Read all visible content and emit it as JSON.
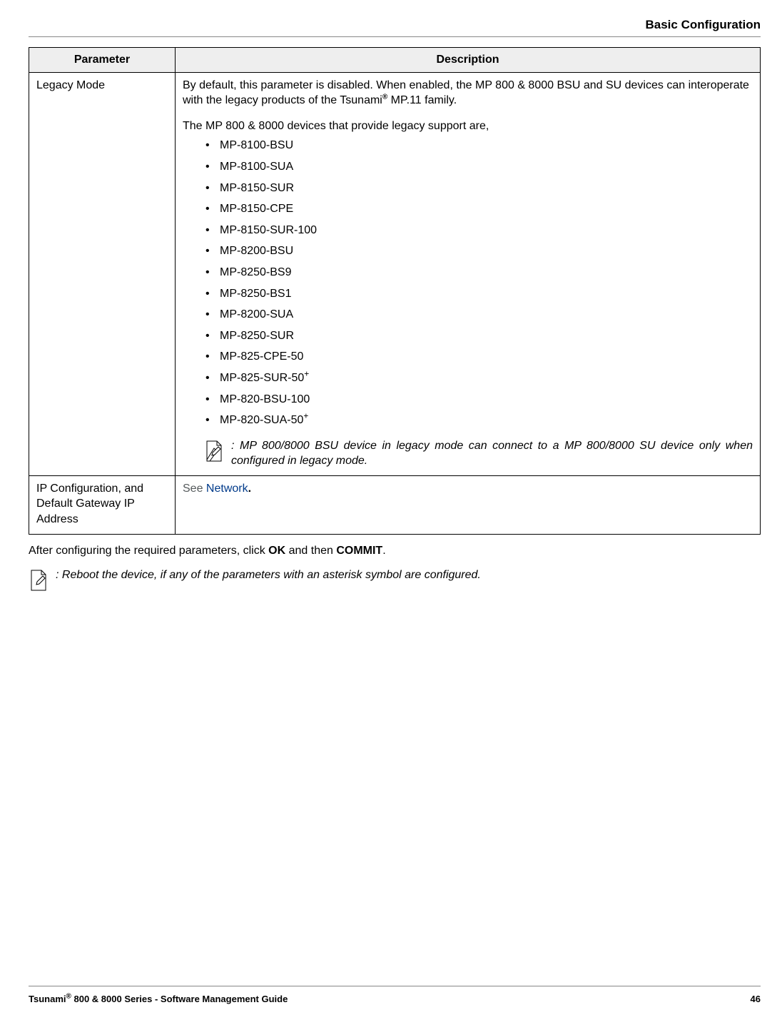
{
  "header": {
    "title": "Basic Configuration"
  },
  "table": {
    "headers": {
      "parameter": "Parameter",
      "description": "Description"
    },
    "rows": [
      {
        "parameter": "Legacy Mode",
        "desc_p1_a": "By default, this parameter is disabled. When enabled, the MP 800 & 8000 BSU and SU devices can interoperate with the legacy products of the Tsunami",
        "desc_p1_b": " MP.11 family.",
        "desc_p2": "The MP 800 & 8000 devices that provide legacy support are,",
        "devices": [
          "MP-8100-BSU",
          "MP-8100-SUA",
          "MP-8150-SUR",
          "MP-8150-CPE",
          "MP-8150-SUR-100",
          "MP-8200-BSU",
          "MP-8250-BS9",
          "MP-8250-BS1",
          "MP-8200-SUA",
          "MP-8250-SUR",
          "MP-825-CPE-50",
          "MP-825-SUR-50",
          "MP-820-BSU-100",
          "MP-820-SUA-50"
        ],
        "note": ": MP 800/8000 BSU device in legacy mode can connect to a MP 800/8000 SU device only when configured in legacy mode."
      },
      {
        "parameter": "IP Configuration, and Default Gateway IP Address",
        "see_word": "See ",
        "see_link": "Network",
        "see_period": "."
      }
    ]
  },
  "body_after": {
    "sentence_a": "After configuring the required parameters, click ",
    "sentence_b": "OK",
    "sentence_c": " and then ",
    "sentence_d": "COMMIT",
    "sentence_e": ".",
    "note": ": Reboot the device, if any of the parameters with an asterisk symbol are configured."
  },
  "footer": {
    "left_a": "Tsunami",
    "left_b": " 800 & 8000 Series - Software Management Guide",
    "page_number": "46"
  }
}
